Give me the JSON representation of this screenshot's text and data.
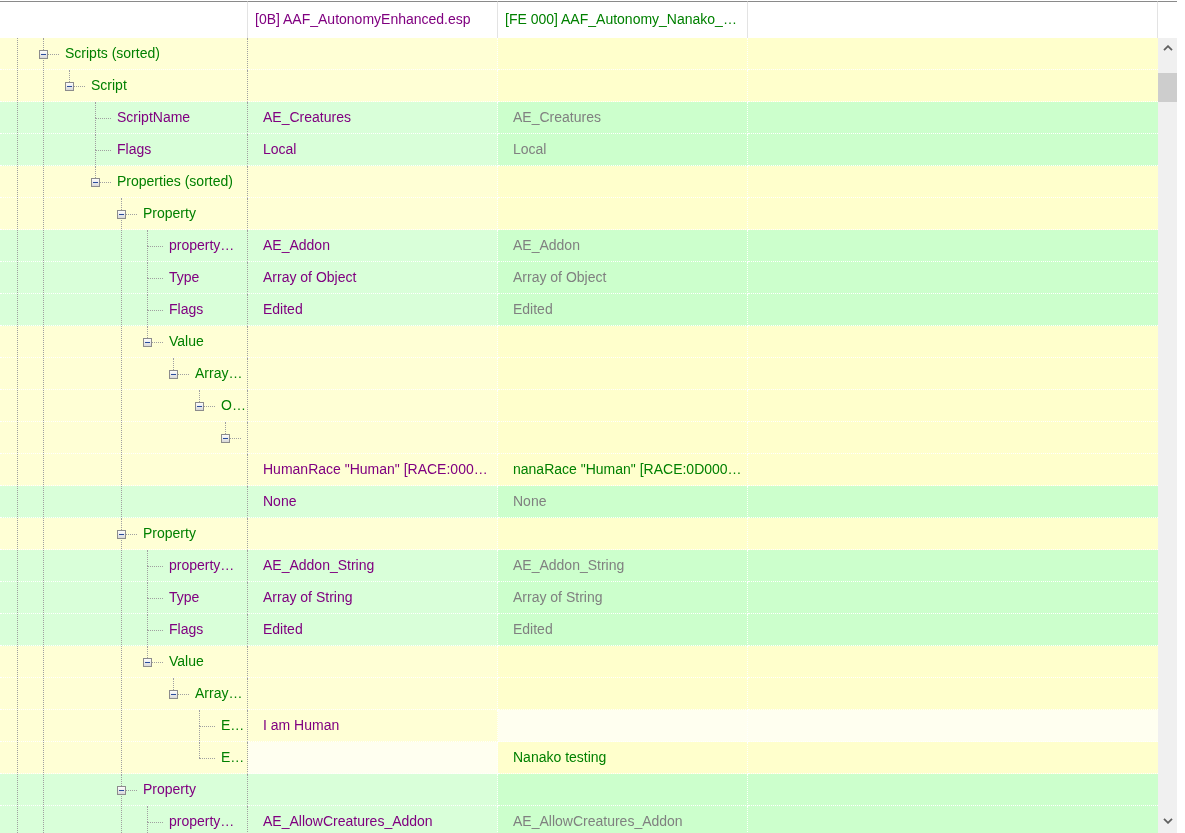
{
  "columns": [
    {
      "title": "[0B] AAF_AutonomyEnhanced.esp",
      "kind": "master"
    },
    {
      "title": "[FE 000] AAF_Autonomy_Nanako_…",
      "kind": "override"
    }
  ],
  "tree": [
    {
      "label": "Scripts (sorted)",
      "kind": "override",
      "expanded": true,
      "more_below": true,
      "children": [
        {
          "label": "Script",
          "kind": "override",
          "expanded": true,
          "children": [
            {
              "label": "ScriptName",
              "kind": "identical",
              "values": [
                {
                  "text": "AE_Creatures",
                  "kind": "master"
                },
                {
                  "text": "AE_Creatures",
                  "kind": "identical"
                }
              ]
            },
            {
              "label": "Flags",
              "kind": "identical",
              "values": [
                {
                  "text": "Local",
                  "kind": "master"
                },
                {
                  "text": "Local",
                  "kind": "identical"
                }
              ]
            },
            {
              "label": "Properties (sorted)",
              "kind": "override",
              "expanded": true,
              "children": [
                {
                  "label": "Property",
                  "kind": "override",
                  "expanded": true,
                  "children": [
                    {
                      "label": "property…",
                      "kind": "identical",
                      "values": [
                        {
                          "text": "AE_Addon",
                          "kind": "master"
                        },
                        {
                          "text": "AE_Addon",
                          "kind": "identical"
                        }
                      ]
                    },
                    {
                      "label": "Type",
                      "kind": "identical",
                      "values": [
                        {
                          "text": "Array of Object",
                          "kind": "master"
                        },
                        {
                          "text": "Array of Object",
                          "kind": "identical"
                        }
                      ]
                    },
                    {
                      "label": "Flags",
                      "kind": "identical",
                      "values": [
                        {
                          "text": "Edited",
                          "kind": "master"
                        },
                        {
                          "text": "Edited",
                          "kind": "identical"
                        }
                      ]
                    },
                    {
                      "label": "Value",
                      "kind": "override",
                      "expanded": true,
                      "children": [
                        {
                          "label": "Array…",
                          "kind": "override",
                          "expanded": true,
                          "children": [
                            {
                              "label": "O…",
                              "kind": "override",
                              "expanded": true,
                              "children": [
                                {
                                  "kind": "override",
                                  "expanded": true,
                                  "children": [
                                    {
                                      "kind": "override",
                                      "values": [
                                        {
                                          "text": "HumanRace \"Human\" [RACE:000…",
                                          "kind": "master"
                                        },
                                        {
                                          "text": "nanaRace \"Human\" [RACE:0D000…",
                                          "kind": "override"
                                        }
                                      ]
                                    },
                                    {
                                      "kind": "identical",
                                      "values": [
                                        {
                                          "text": "None",
                                          "kind": "master"
                                        },
                                        {
                                          "text": "None",
                                          "kind": "identical"
                                        }
                                      ]
                                    }
                                  ]
                                }
                              ]
                            }
                          ]
                        }
                      ]
                    }
                  ]
                },
                {
                  "label": "Property",
                  "kind": "override",
                  "expanded": true,
                  "children": [
                    {
                      "label": "property…",
                      "kind": "identical",
                      "values": [
                        {
                          "text": "AE_Addon_String",
                          "kind": "master"
                        },
                        {
                          "text": "AE_Addon_String",
                          "kind": "identical"
                        }
                      ]
                    },
                    {
                      "label": "Type",
                      "kind": "identical",
                      "values": [
                        {
                          "text": "Array of String",
                          "kind": "master"
                        },
                        {
                          "text": "Array of String",
                          "kind": "identical"
                        }
                      ]
                    },
                    {
                      "label": "Flags",
                      "kind": "identical",
                      "values": [
                        {
                          "text": "Edited",
                          "kind": "master"
                        },
                        {
                          "text": "Edited",
                          "kind": "identical"
                        }
                      ]
                    },
                    {
                      "label": "Value",
                      "kind": "override",
                      "expanded": true,
                      "children": [
                        {
                          "label": "Array…",
                          "kind": "override",
                          "expanded": true,
                          "children": [
                            {
                              "label": "E…",
                              "kind": "override",
                              "values": [
                                {
                                  "text": "I am Human",
                                  "kind": "master"
                                },
                                {
                                  "kind": "absent"
                                }
                              ]
                            },
                            {
                              "label": "E…",
                              "kind": "override",
                              "values": [
                                {
                                  "kind": "absent"
                                },
                                {
                                  "text": "Nanako testing",
                                  "kind": "override"
                                }
                              ]
                            }
                          ]
                        }
                      ]
                    }
                  ]
                },
                {
                  "label": "Property",
                  "kind": "identical",
                  "expanded": true,
                  "more_below": true,
                  "children": [
                    {
                      "label": "property…",
                      "kind": "identical",
                      "more_below": true,
                      "values": [
                        {
                          "text": "AE_AllowCreatures_Addon",
                          "kind": "master"
                        },
                        {
                          "text": "AE_AllowCreatures_Addon",
                          "kind": "identical"
                        }
                      ]
                    }
                  ]
                }
              ]
            }
          ]
        }
      ]
    }
  ]
}
